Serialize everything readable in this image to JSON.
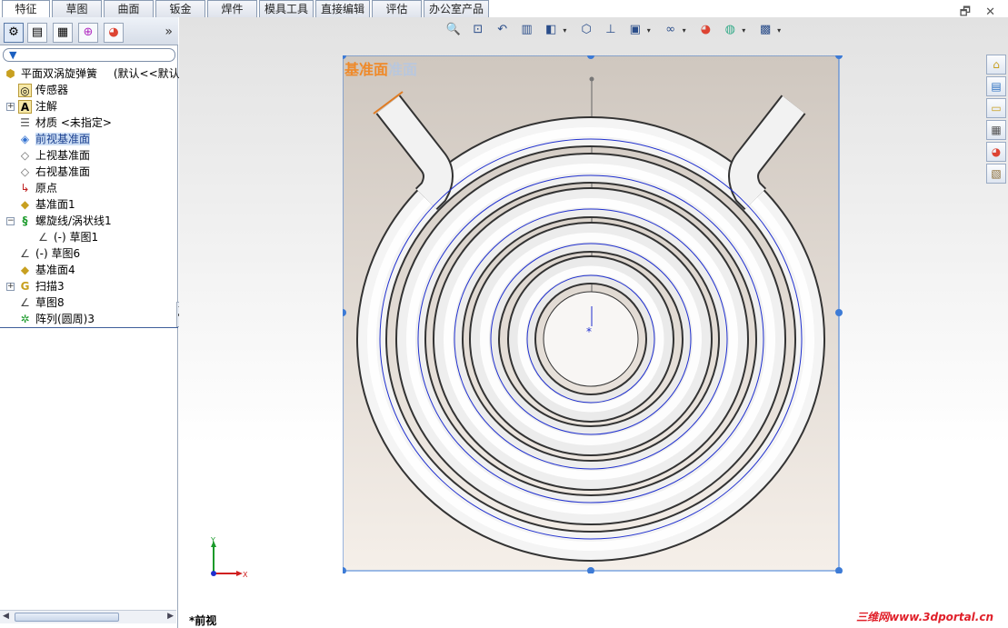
{
  "tabs": [
    {
      "label": "特征",
      "active": true
    },
    {
      "label": "草图",
      "active": false
    },
    {
      "label": "曲面",
      "active": false
    },
    {
      "label": "钣金",
      "active": false
    },
    {
      "label": "焊件",
      "active": false
    },
    {
      "label": "模具工具",
      "active": false
    },
    {
      "label": "直接编辑",
      "active": false
    },
    {
      "label": "评估",
      "active": false
    },
    {
      "label": "办公室产品",
      "active": false
    }
  ],
  "window_controls": {
    "minimize": "_",
    "restore": "🗗",
    "close": "✕"
  },
  "panel_tabs": [
    "feature-manager-icon",
    "property-manager-icon",
    "configuration-manager-icon",
    "dimxpert-icon",
    "display-manager-icon"
  ],
  "panel_expand": "»",
  "tree": {
    "root": {
      "label": "平面双涡旋弹簧",
      "config": "(默认<<默认>"
    },
    "items": [
      {
        "label": "传感器",
        "icon": "sensor-icon"
      },
      {
        "label": "注解",
        "icon": "annotation-icon"
      },
      {
        "label": "材质 <未指定>",
        "icon": "material-icon"
      },
      {
        "label": "前视基准面",
        "icon": "plane-icon",
        "selected": true
      },
      {
        "label": "上视基准面",
        "icon": "plane-icon"
      },
      {
        "label": "右视基准面",
        "icon": "plane-icon"
      },
      {
        "label": "原点",
        "icon": "origin-icon"
      },
      {
        "label": "基准面1",
        "icon": "plane-icon"
      },
      {
        "label": "螺旋线/涡状线1",
        "icon": "helix-icon"
      },
      {
        "label": "(-) 草图1",
        "icon": "sketch-icon"
      },
      {
        "label": "(-) 草图6",
        "icon": "sketch-icon"
      },
      {
        "label": "基准面4",
        "icon": "plane-icon"
      },
      {
        "label": "扫描3",
        "icon": "sweep-icon"
      },
      {
        "label": "草图8",
        "icon": "sketch-icon"
      },
      {
        "label": "阵列(圆周)3",
        "icon": "circular-pattern-icon"
      }
    ]
  },
  "viewport": {
    "plane_label": "基准面",
    "plane_label_ghost": "准面",
    "view_name": "*前视",
    "watermark": "三维网www.3dportal.cn",
    "triad_x": "X",
    "triad_y": "Y"
  },
  "colors": {
    "plane_label": "#ef8a2a",
    "selection_box": "#3d7bd6",
    "sketch_line": "#1f2fcf",
    "watermark": "#e0202a"
  }
}
